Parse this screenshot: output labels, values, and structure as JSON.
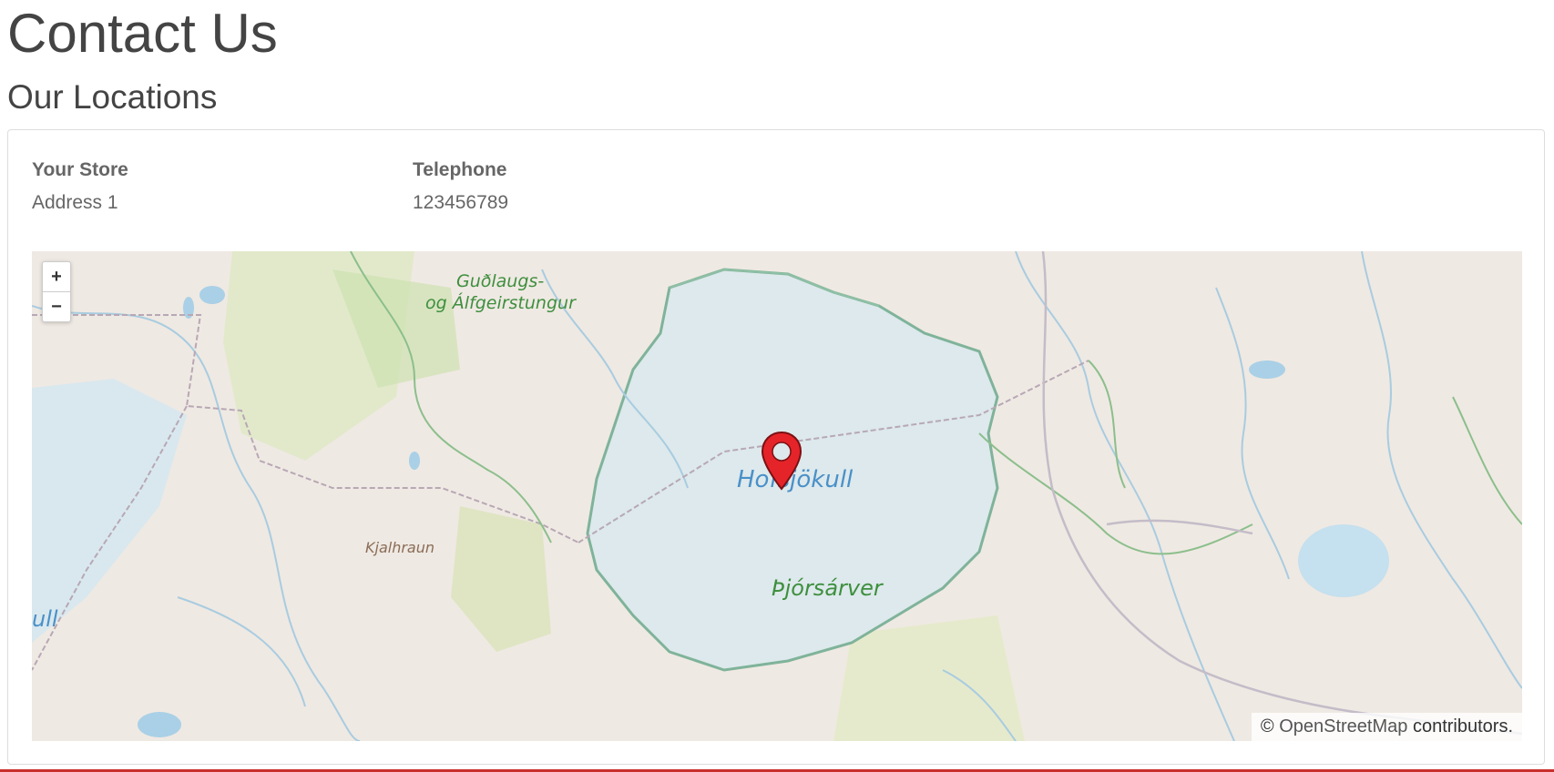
{
  "page": {
    "title": "Contact Us",
    "section_title": "Our Locations"
  },
  "location": {
    "store_label": "Your Store",
    "address": "Address 1",
    "telephone_label": "Telephone",
    "telephone": "123456789"
  },
  "map": {
    "zoom_in_label": "+",
    "zoom_out_label": "−",
    "labels": {
      "region_1a": "Guðlaugs-",
      "region_1b": "og Álfgeirstungur",
      "glacier": "Hofsjökull",
      "wetland": "Þjórsárver",
      "lava": "Kjalhraun",
      "edge_glacier": "ull"
    },
    "attribution_prefix": "© ",
    "attribution_link": "OpenStreetMap",
    "attribution_suffix": " contributors.",
    "marker_color": "#e5242a"
  }
}
